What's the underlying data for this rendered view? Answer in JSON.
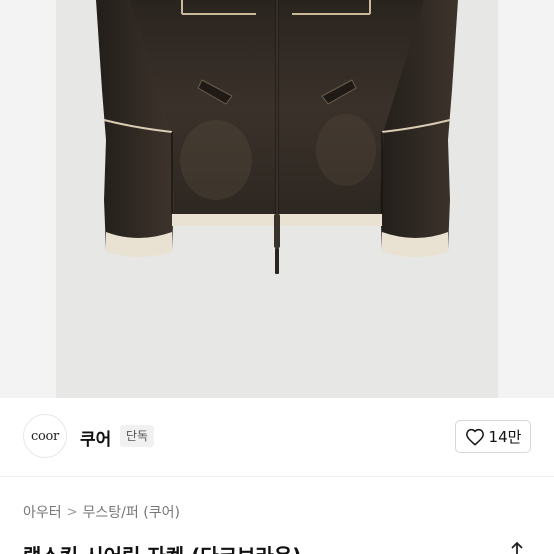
{
  "product": {
    "image_alt": "dark brown shearling jacket",
    "title": "램스킨 시어링 자켓 (다크브라운)"
  },
  "brand": {
    "logo_text": "coor",
    "name": "쿠어",
    "badge": "단독"
  },
  "like": {
    "count": "14만",
    "icon": "heart-outline-icon"
  },
  "breadcrumb": {
    "items": [
      "아우터",
      "무스탕/퍼 (쿠어)"
    ],
    "separator": ">"
  },
  "share": {
    "icon": "share-icon"
  },
  "colors": {
    "jacket": "#2b2520",
    "shearling": "#e9e2d3",
    "background": "#e7e7e5"
  }
}
